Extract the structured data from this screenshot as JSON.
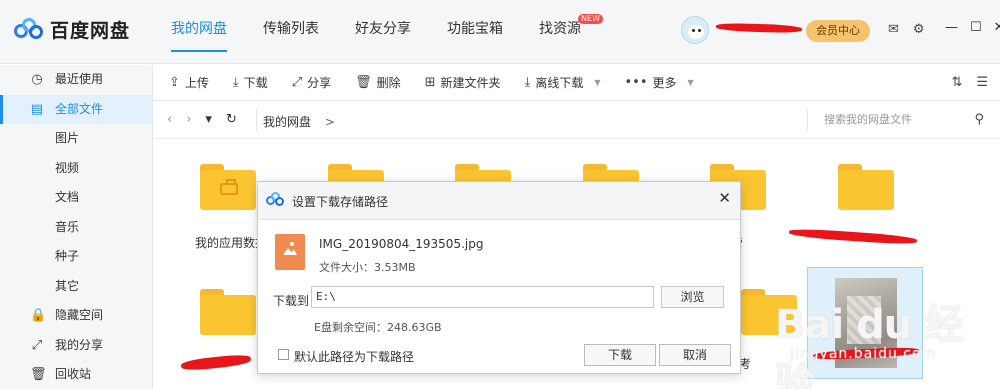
{
  "app": {
    "logo_text": "百度网盘"
  },
  "main_tabs": [
    {
      "label": "我的网盘"
    },
    {
      "label": "传输列表"
    },
    {
      "label": "好友分享"
    },
    {
      "label": "功能宝箱"
    },
    {
      "label": "找资源",
      "badge": "NEW"
    }
  ],
  "header": {
    "vip_label": "会员中心",
    "mail_icon": "✉",
    "settings_icon": "⚙",
    "min_icon": "—",
    "max_icon": "☐",
    "close_icon": "✕"
  },
  "sidebar": {
    "items": [
      {
        "label": "最近使用",
        "icon": "◷"
      },
      {
        "label": "全部文件",
        "icon": "▤"
      },
      {
        "label": "图片"
      },
      {
        "label": "视频"
      },
      {
        "label": "文档"
      },
      {
        "label": "音乐"
      },
      {
        "label": "种子"
      },
      {
        "label": "其它"
      },
      {
        "label": "隐藏空间",
        "icon": "🔒"
      },
      {
        "label": "我的分享",
        "icon": "⤢"
      },
      {
        "label": "回收站",
        "icon": "🗑"
      }
    ]
  },
  "toolbar": {
    "upload": "上传",
    "download": "下载",
    "share": "分享",
    "delete": "删除",
    "new_folder": "新建文件夹",
    "offline_download": "离线下载",
    "more": "更多"
  },
  "address": {
    "path_root": "我的网盘",
    "path_sep": ">",
    "search_placeholder": "搜索我的网盘文件"
  },
  "files": {
    "items": [
      {
        "name": "我的应用数据"
      },
      {
        "name": ""
      },
      {
        "name": ""
      },
      {
        "name": "管"
      },
      {
        "name": ""
      },
      {
        "name": ""
      },
      {
        "name": ""
      },
      {
        "name": ""
      },
      {
        "name": ""
      },
      {
        "name": "考"
      }
    ]
  },
  "watermark": {
    "main": "Bai du 经验",
    "sub": "jingyan.baidu.com"
  },
  "dialog": {
    "title": "设置下载存储路径",
    "file_name": "IMG_20190804_193505.jpg",
    "file_size": "文件大小：3.53MB",
    "download_to_label": "下载到",
    "path_value": "E:\\",
    "browse_label": "浏览",
    "free_space": "E盘剩余空间：248.63GB",
    "default_path_label": "默认此路径为下载路径",
    "download_button": "下载",
    "cancel_button": "取消"
  },
  "colors": {
    "accent": "#1e8cf0",
    "folder": "#fbc531",
    "vip": "#f4c36b"
  }
}
